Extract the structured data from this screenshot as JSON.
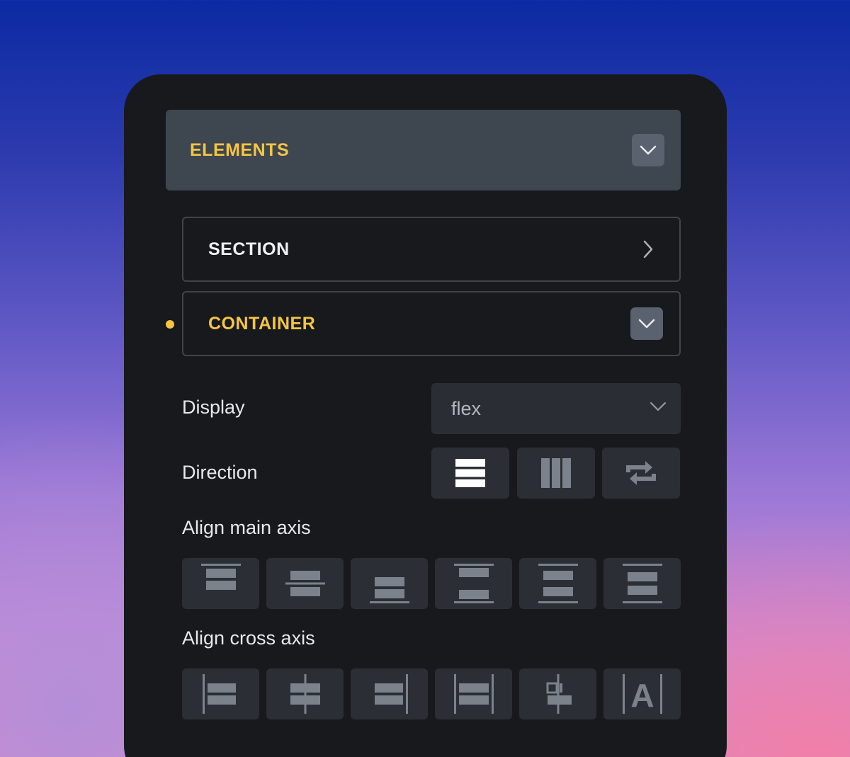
{
  "panel": {
    "elements_header": {
      "title": "ELEMENTS",
      "toggle_icon": "chevron-down-icon"
    },
    "section_row": {
      "title": "SECTION",
      "icon": "chevron-right-icon"
    },
    "container_row": {
      "title": "CONTAINER",
      "icon": "chevron-down-icon",
      "active": true
    },
    "display": {
      "label": "Display",
      "value": "flex",
      "icon": "chevron-down-icon"
    },
    "direction": {
      "label": "Direction",
      "options": [
        {
          "name": "column",
          "icon": "direction-column-icon",
          "selected": true
        },
        {
          "name": "row",
          "icon": "direction-row-icon",
          "selected": false
        },
        {
          "name": "reverse",
          "icon": "direction-reverse-icon",
          "selected": false
        }
      ]
    },
    "align_main_axis": {
      "label": "Align main axis",
      "options": [
        "start",
        "center",
        "end",
        "space-between",
        "space-around",
        "space-evenly"
      ]
    },
    "align_cross_axis": {
      "label": "Align cross axis",
      "options": [
        "start",
        "center",
        "end",
        "stretch",
        "baseline-center",
        "baseline-text"
      ],
      "baseline_glyph": "A"
    }
  },
  "colors": {
    "accent": "#f5c542",
    "panel_bg": "#17191d",
    "header_bg": "#3e4650",
    "button_bg": "#2b2f35",
    "icon_active": "#ffffff",
    "icon_inactive": "#7c828b"
  }
}
